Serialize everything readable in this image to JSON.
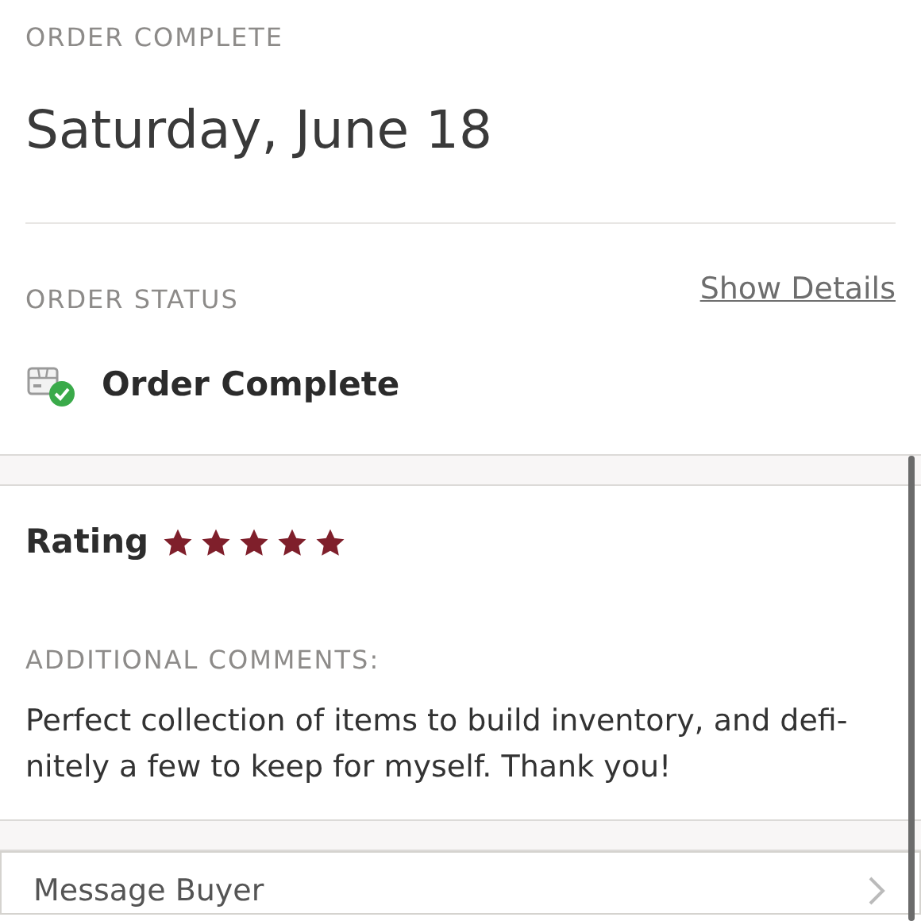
{
  "header": {
    "label": "ORDER COMPLETE",
    "date": "Saturday, June 18"
  },
  "order_status": {
    "label": "ORDER STATUS",
    "link": "Show Details",
    "status": "Order Complete",
    "complete": true
  },
  "rating": {
    "label": "Rating",
    "stars": 5
  },
  "comments": {
    "label": "ADDITIONAL COMMENTS:",
    "text": "Perfect collection of items to build inventory, and defi-nitely a few to keep for myself. Thank you!"
  },
  "action": {
    "label": "Message Buyer"
  }
}
